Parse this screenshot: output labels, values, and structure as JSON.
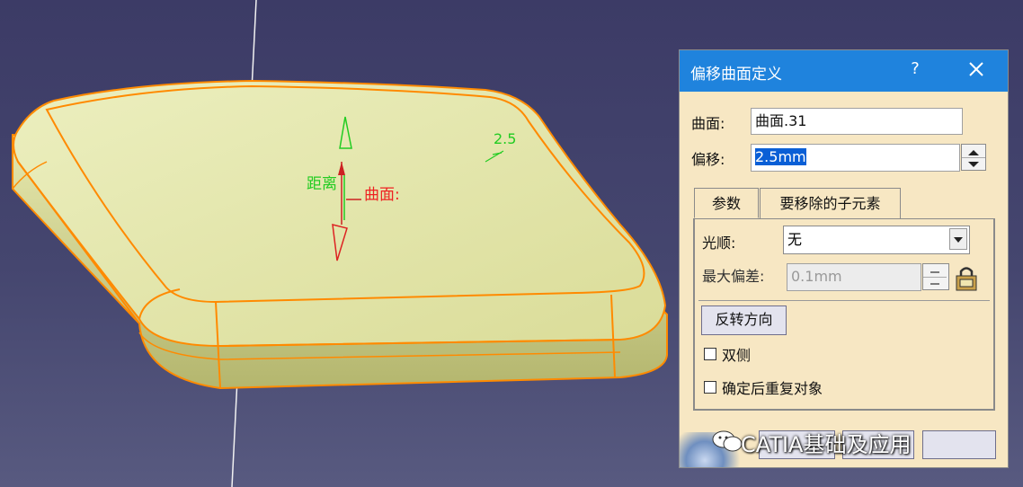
{
  "viewport": {
    "annotation_distance": "距离",
    "annotation_surface": "曲面:",
    "annotation_value": "2.5"
  },
  "dialog": {
    "title": "偏移曲面定义",
    "help": "?",
    "surface_label": "曲面:",
    "surface_value": "曲面.31",
    "offset_label": "偏移:",
    "offset_value": "2.5mm",
    "tabs": [
      "参数",
      "要移除的子元素"
    ],
    "smoothing_label": "光顺:",
    "smoothing_value": "无",
    "max_deviation_label": "最大偏差:",
    "max_deviation_value": "0.1mm",
    "reverse_button": "反转方向",
    "both_sides_label": "双侧",
    "repeat_label": "确定后重复对象"
  },
  "watermark": "CATIA基础及应用",
  "colors": {
    "background": "#3c3b66",
    "surface_fill": "#e2e4a6",
    "edge": "#ff8a00",
    "titlebar": "#1f83dd",
    "dialog_bg": "#f7e7c3"
  }
}
